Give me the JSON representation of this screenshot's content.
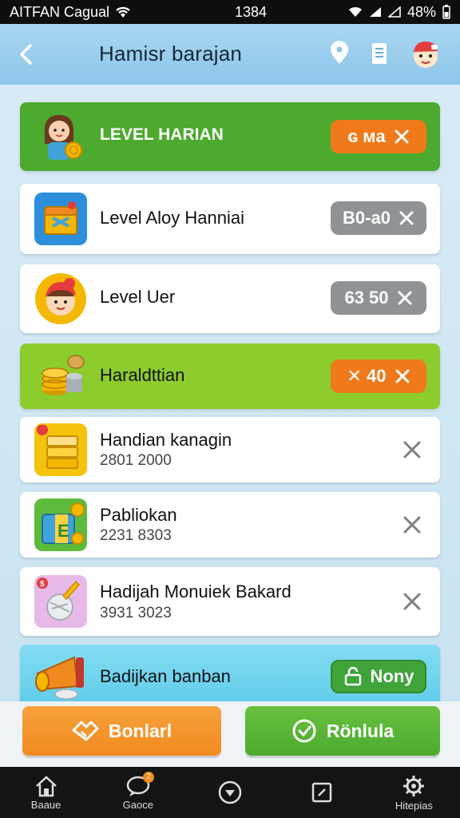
{
  "status_bar": {
    "carrier": "AITFAN Cagual",
    "time": "1384",
    "battery": "48%"
  },
  "header": {
    "title": "Hamisr barajan"
  },
  "items": [
    {
      "title": "LEVEL HARIAN",
      "pill": "ɢ мa",
      "style": "green",
      "icon": "girl-with-coin-icon"
    },
    {
      "title": "Level Aloy Hanniai",
      "pill": "B0-a0",
      "style": "white",
      "icon": "treasure-box-icon"
    },
    {
      "title": "Level Uer",
      "pill": "63 50",
      "style": "white",
      "icon": "character-face-icon"
    },
    {
      "title": "Haraldttian",
      "pill": "✕ 40",
      "style": "lime",
      "icon": "coin-stack-icon"
    },
    {
      "title": "Handian kanagin",
      "subtitle": "2801 2000",
      "style": "white",
      "icon": "gold-bar-icon"
    },
    {
      "title": "Pabliokan",
      "subtitle": "2231 8303",
      "style": "white",
      "icon": "gift-pack-icon"
    },
    {
      "title": "Hadijah Monuiek Bakard",
      "subtitle": "3931 3023",
      "style": "white",
      "icon": "trophy-icon"
    },
    {
      "title": "Badijkan banban",
      "pill": "Nony",
      "style": "cyan",
      "icon": "megaphone-icon"
    }
  ],
  "actions": {
    "left_label": "Bonlarl",
    "right_label": "Rönlula"
  },
  "nav": [
    {
      "label": "Baaue",
      "icon": "home-icon"
    },
    {
      "label": "Gaoce",
      "icon": "chat-icon",
      "badge": "2"
    },
    {
      "label": "",
      "icon": "compass-icon"
    },
    {
      "label": "",
      "icon": "edit-box-icon"
    },
    {
      "label": "Hitepias",
      "icon": "settings-icon"
    }
  ],
  "colors": {
    "header": "#8ec6ea",
    "green": "#4caa2f",
    "lime": "#8ccc2c",
    "orange": "#f07a1b",
    "gray_pill": "#8f9396"
  }
}
